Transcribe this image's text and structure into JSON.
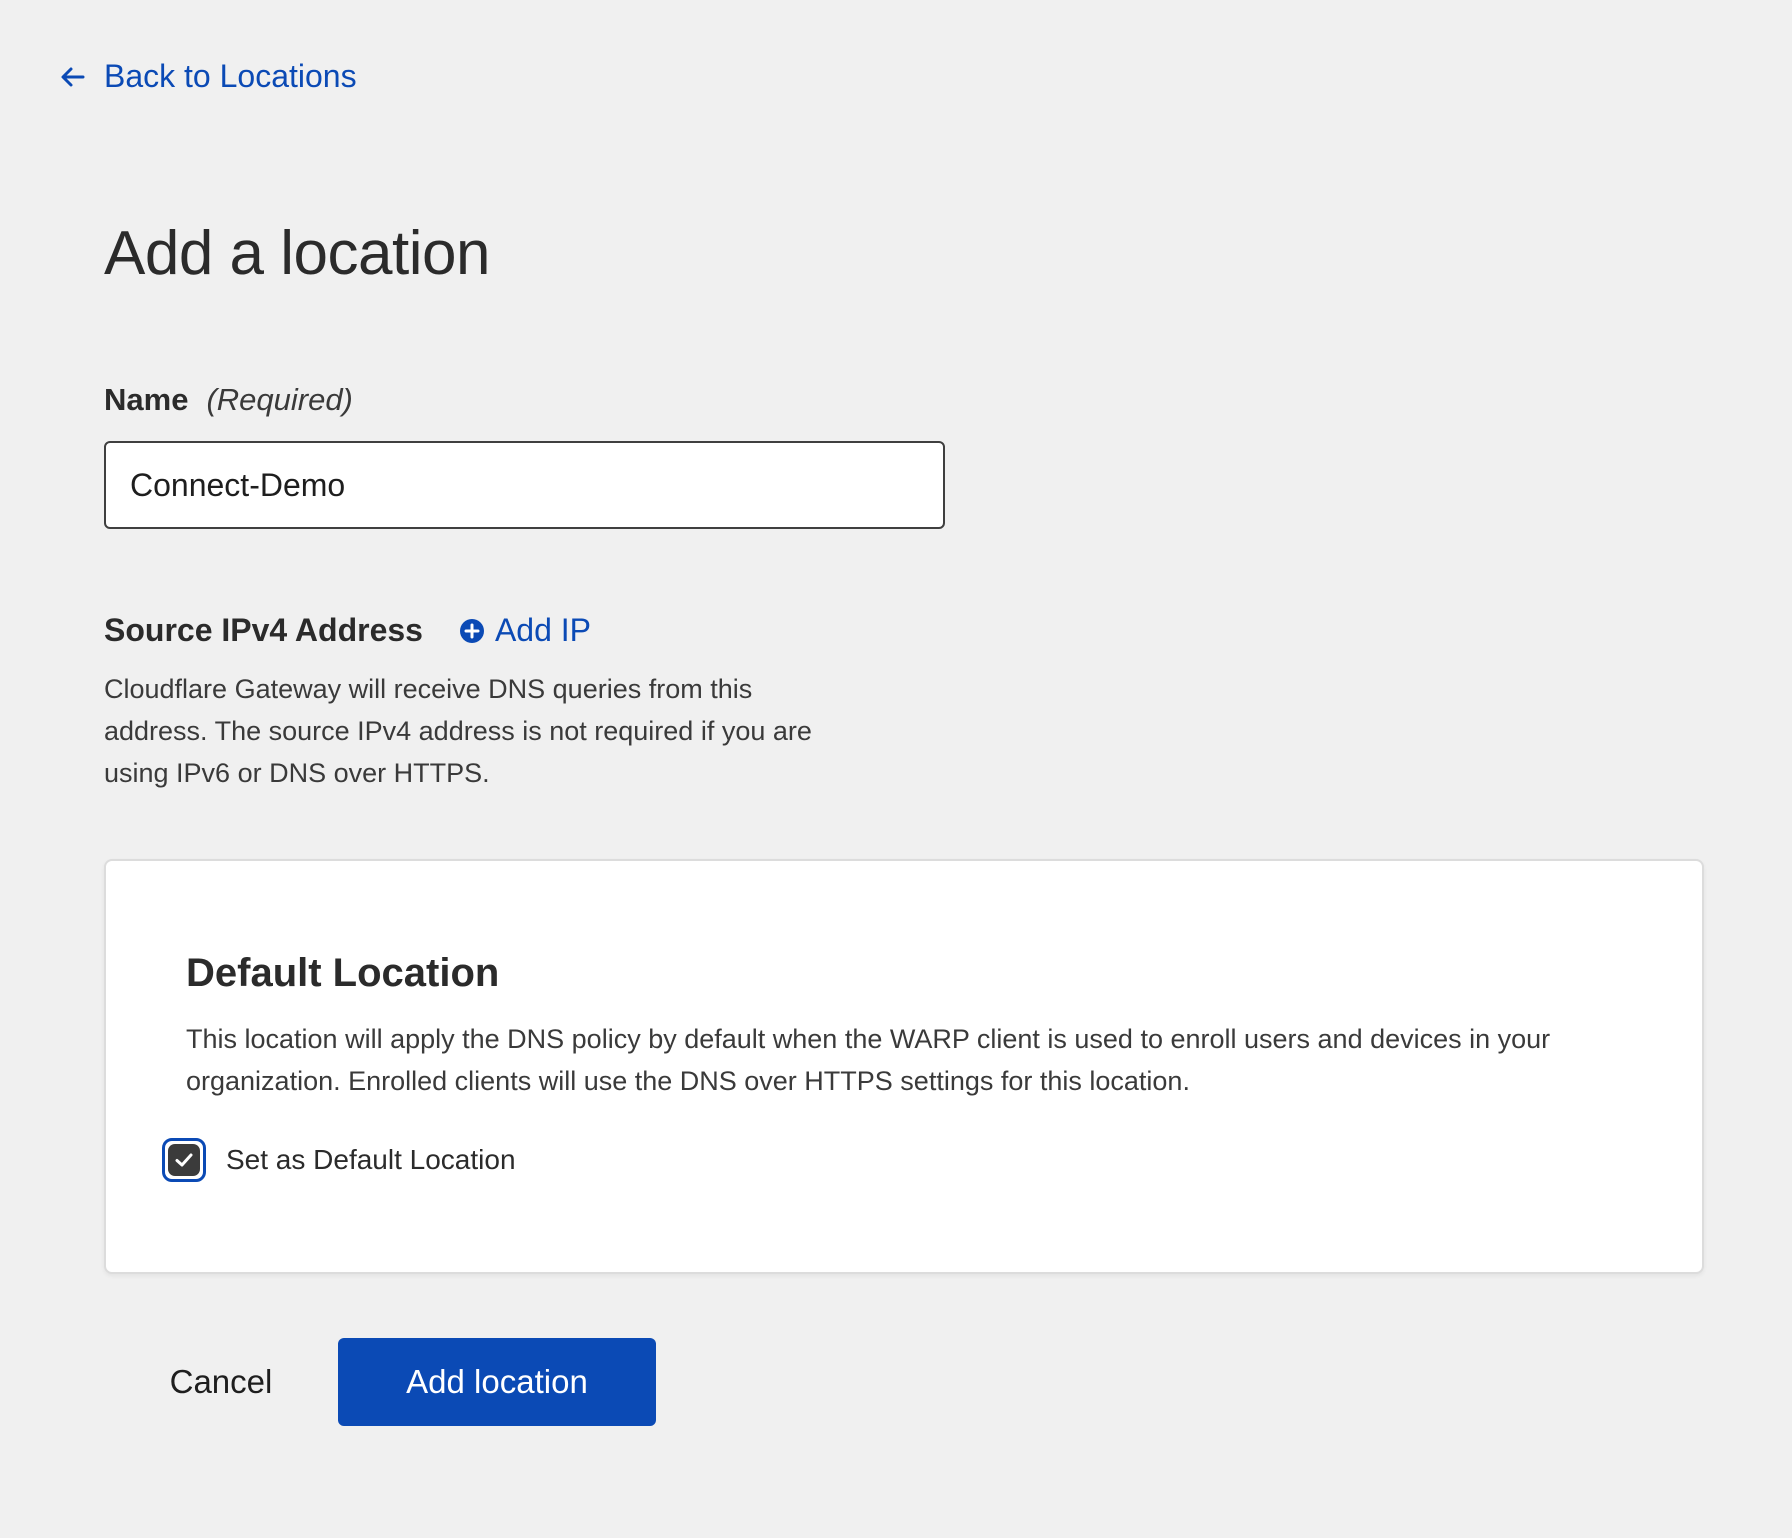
{
  "nav": {
    "back_label": "Back to Locations",
    "back_icon": "arrow-left-icon"
  },
  "page": {
    "title": "Add a location"
  },
  "name_field": {
    "label": "Name",
    "required_note": "(Required)",
    "value": "Connect-Demo"
  },
  "source_ip": {
    "label": "Source IPv4 Address",
    "add_label": "Add IP",
    "add_icon": "plus-circle-icon",
    "description": "Cloudflare Gateway will receive DNS queries from this address. The source IPv4 address is not required if you are using IPv6 or DNS over HTTPS."
  },
  "default_location": {
    "title": "Default Location",
    "description": "This location will apply the DNS policy by default when the WARP client is used to enroll users and devices in your organization. Enrolled clients will use the DNS over HTTPS settings for this location.",
    "checkbox_label": "Set as Default Location",
    "checked": true
  },
  "actions": {
    "cancel_label": "Cancel",
    "submit_label": "Add location"
  },
  "colors": {
    "accent": "#0b4ab5",
    "background": "#f0f0f0",
    "card": "#ffffff",
    "text": "#313131"
  }
}
